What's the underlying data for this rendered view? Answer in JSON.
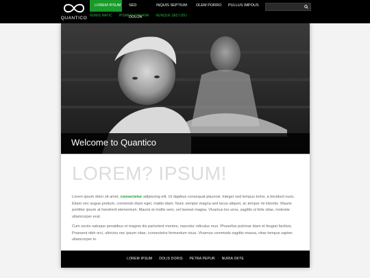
{
  "brand": {
    "name": "QUANTICO",
    "logo_icon": "infinity-icon"
  },
  "nav": {
    "items": [
      {
        "label": "LOREM IPSUM",
        "active": true
      },
      {
        "label": "SED DOLOR",
        "active": false
      },
      {
        "label": "INQUIS SEPTIUM",
        "active": false
      },
      {
        "label": "OLEM PORRO",
        "active": false
      },
      {
        "label": "PULLUS IMPOUS",
        "active": false
      }
    ],
    "subitems": [
      {
        "label": "NUMIS MATIC"
      },
      {
        "label": "IPSIMUS ORGANA"
      },
      {
        "label": "NUNQUE SED UDU"
      }
    ]
  },
  "search": {
    "placeholder": "",
    "icon": "search-icon"
  },
  "hero": {
    "caption": "Welcome to Quantico"
  },
  "content": {
    "headline": "LOREM? IPSUM!",
    "p1_start": "Lorem ipsum dolor sit amet, ",
    "p1_highlight": "consectetur",
    "p1_end": " adipiscing elit. Ut dapibus consequat placerat. Integer sed tempus tortor, a tincidunt nunc. Etiam nec augue pretium, commodo diam eget, mattis diam. Nunc semper magna sed lacus aliquet, ac tempor mi lobortis. Mauris porttitor ipsum at hendrerit elementum. Mauris et mollis sem, vel laoreet magna. Vivamus leo urna, sagittis ut felis vitae, molestie ullamcorper erat.",
    "p2": "Cum sociis natoque penatibus et magnis dis parturient montes, nascetur ridiculus mus. Phasellus pulvinar diam et feugiat facilisis. Praesent nibh orci, ultricies nec ipsum vitae, consectetur fermentum risus. Vivamus commodo sagittis massa, vitae tempus sapien ullamcorper in."
  },
  "footer": {
    "links": [
      {
        "label": "LOREM IPSUM"
      },
      {
        "label": "DOLIS DORIS"
      },
      {
        "label": "PETRA PEPUR"
      },
      {
        "label": "NURIA OKTE"
      }
    ],
    "separator": "·"
  },
  "colors": {
    "accent": "#1a9a2a",
    "topbar": "#000000",
    "headline": "#dcdcdc"
  }
}
